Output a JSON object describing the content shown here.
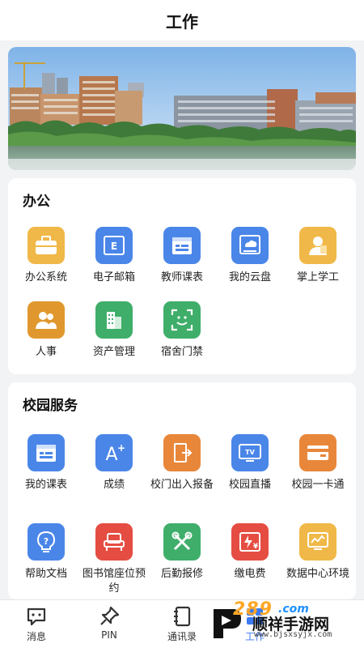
{
  "header": {
    "title": "工作"
  },
  "office": {
    "title": "办公",
    "items": [
      {
        "label": "办公系统",
        "icon": "briefcase-icon",
        "color": "#f0b848"
      },
      {
        "label": "电子邮箱",
        "icon": "email-icon",
        "color": "#4a86e8"
      },
      {
        "label": "教师课表",
        "icon": "schedule-icon",
        "color": "#4a86e8"
      },
      {
        "label": "我的云盘",
        "icon": "cloud-disk-icon",
        "color": "#4a86e8"
      },
      {
        "label": "掌上学工",
        "icon": "student-work-icon",
        "color": "#f0b848"
      },
      {
        "label": "人事",
        "icon": "people-icon",
        "color": "#e0982e"
      },
      {
        "label": "资产管理",
        "icon": "building-icon",
        "color": "#3fae6a"
      },
      {
        "label": "宿舍门禁",
        "icon": "face-scan-icon",
        "color": "#3fae6a"
      }
    ]
  },
  "campus": {
    "title": "校园服务",
    "items": [
      {
        "label": "我的课表",
        "icon": "schedule-icon",
        "color": "#4a86e8"
      },
      {
        "label": "成绩",
        "icon": "grade-icon",
        "color": "#4a86e8"
      },
      {
        "label": "校门出入报备",
        "icon": "door-exit-icon",
        "color": "#e8873a"
      },
      {
        "label": "校园直播",
        "icon": "tv-icon",
        "color": "#4a86e8"
      },
      {
        "label": "校园一卡通",
        "icon": "card-icon",
        "color": "#e8873a"
      },
      {
        "label": "帮助文档",
        "icon": "help-bulb-icon",
        "color": "#4a86e8"
      },
      {
        "label": "图书馆座位预约",
        "icon": "seat-icon",
        "color": "#e54d42"
      },
      {
        "label": "后勤报修",
        "icon": "repair-tools-icon",
        "color": "#3fae6a"
      },
      {
        "label": "缴电费",
        "icon": "electricity-bill-icon",
        "color": "#e54d42"
      },
      {
        "label": "数据中心环境",
        "icon": "data-monitor-icon",
        "color": "#f0b848"
      }
    ]
  },
  "tabbar": {
    "tabs": [
      {
        "label": "消息",
        "icon": "message-icon"
      },
      {
        "label": "PIN",
        "icon": "pin-icon"
      },
      {
        "label": "通讯录",
        "icon": "contacts-icon"
      },
      {
        "label": "工作",
        "icon": "work-icon",
        "active": true
      }
    ]
  },
  "watermark": {
    "number": "289",
    "domain_suffix": ".com",
    "name": "顺祥手游网",
    "url": "www.bjsxsyjx.com"
  }
}
